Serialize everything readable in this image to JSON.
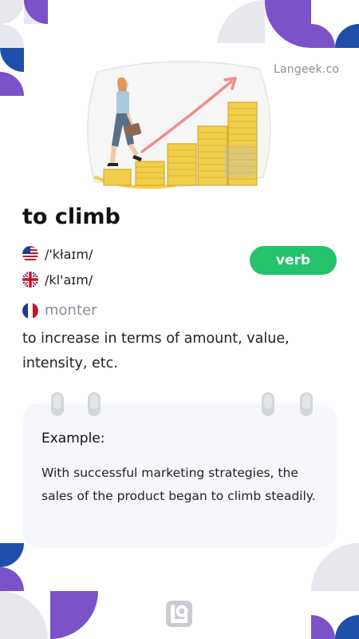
{
  "brand": {
    "name": "Langeek.co"
  },
  "entry": {
    "word": "to climb",
    "part_of_speech": "verb",
    "pronunciations": [
      {
        "region": "us",
        "ipa": "/'kłaɪm/"
      },
      {
        "region": "uk",
        "ipa": "/kl'aɪm/"
      }
    ],
    "translation": {
      "language": "fr",
      "text": "monter"
    },
    "definition": "to increase in terms of amount, value, intensity, etc."
  },
  "example": {
    "title": "Example:",
    "text": "With successful marketing strategies, the sales of the product began to climb steadily."
  },
  "colors": {
    "accent_green": "#24c26a",
    "deco_purple": "#7b52c8",
    "deco_blue": "#1f4fa8",
    "deco_gray": "#e6e8ee",
    "arrow": "#f28b8b",
    "coin": "#f2cf4a"
  },
  "icons": {
    "us_flag": "us-flag-icon",
    "uk_flag": "uk-flag-icon",
    "fr_flag": "france-flag-icon",
    "logo": "langeek-logo-icon"
  }
}
